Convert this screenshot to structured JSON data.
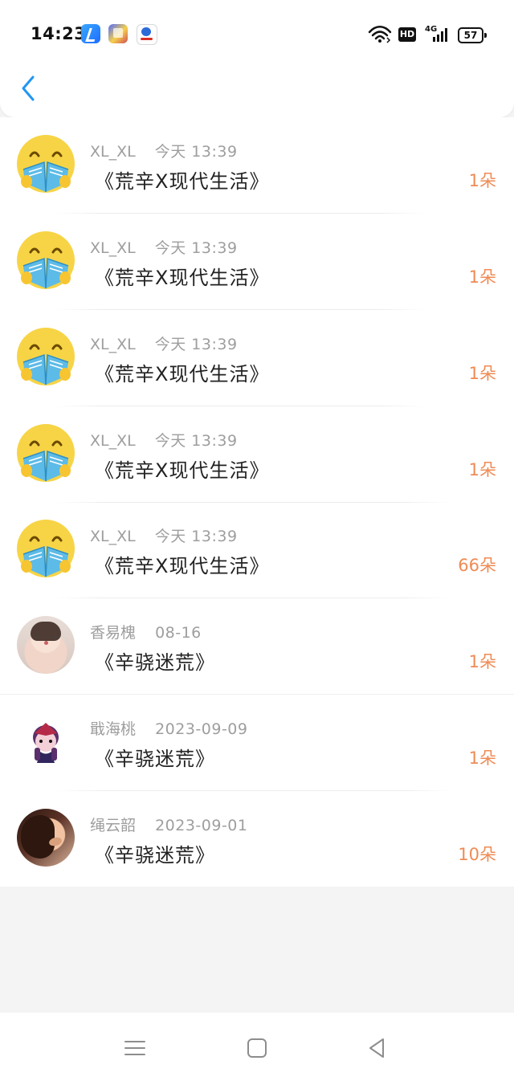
{
  "status_bar": {
    "time": "14:23",
    "network_badge": "HD",
    "network_type": "4G",
    "battery": "57"
  },
  "list": [
    {
      "avatar": "book-reading-emoji",
      "user_name": "XL_XL",
      "timestamp": "今天 13:39",
      "title": "《荒辛X现代生活》",
      "amount": "1朵"
    },
    {
      "avatar": "book-reading-emoji",
      "user_name": "XL_XL",
      "timestamp": "今天 13:39",
      "title": "《荒辛X现代生活》",
      "amount": "1朵"
    },
    {
      "avatar": "book-reading-emoji",
      "user_name": "XL_XL",
      "timestamp": "今天 13:39",
      "title": "《荒辛X现代生活》",
      "amount": "1朵"
    },
    {
      "avatar": "book-reading-emoji",
      "user_name": "XL_XL",
      "timestamp": "今天 13:39",
      "title": "《荒辛X现代生活》",
      "amount": "1朵"
    },
    {
      "avatar": "book-reading-emoji",
      "user_name": "XL_XL",
      "timestamp": "今天 13:39",
      "title": "《荒辛X现代生活》",
      "amount": "66朵"
    },
    {
      "avatar": "girl-photo",
      "user_name": "香易槐",
      "timestamp": "08-16",
      "title": "《辛骁迷荒》",
      "amount": "1朵"
    },
    {
      "avatar": "game-character",
      "user_name": "戢海桃",
      "timestamp": "2023-09-09",
      "title": "《辛骁迷荒》",
      "amount": "1朵"
    },
    {
      "avatar": "woman-photo",
      "user_name": "绳云韶",
      "timestamp": "2023-09-01",
      "title": "《辛骁迷荒》",
      "amount": "10朵"
    }
  ],
  "colors": {
    "accent": "#2196f3",
    "amount": "#ef8b55",
    "meta": "#9e9e9e",
    "title": "#222222"
  }
}
